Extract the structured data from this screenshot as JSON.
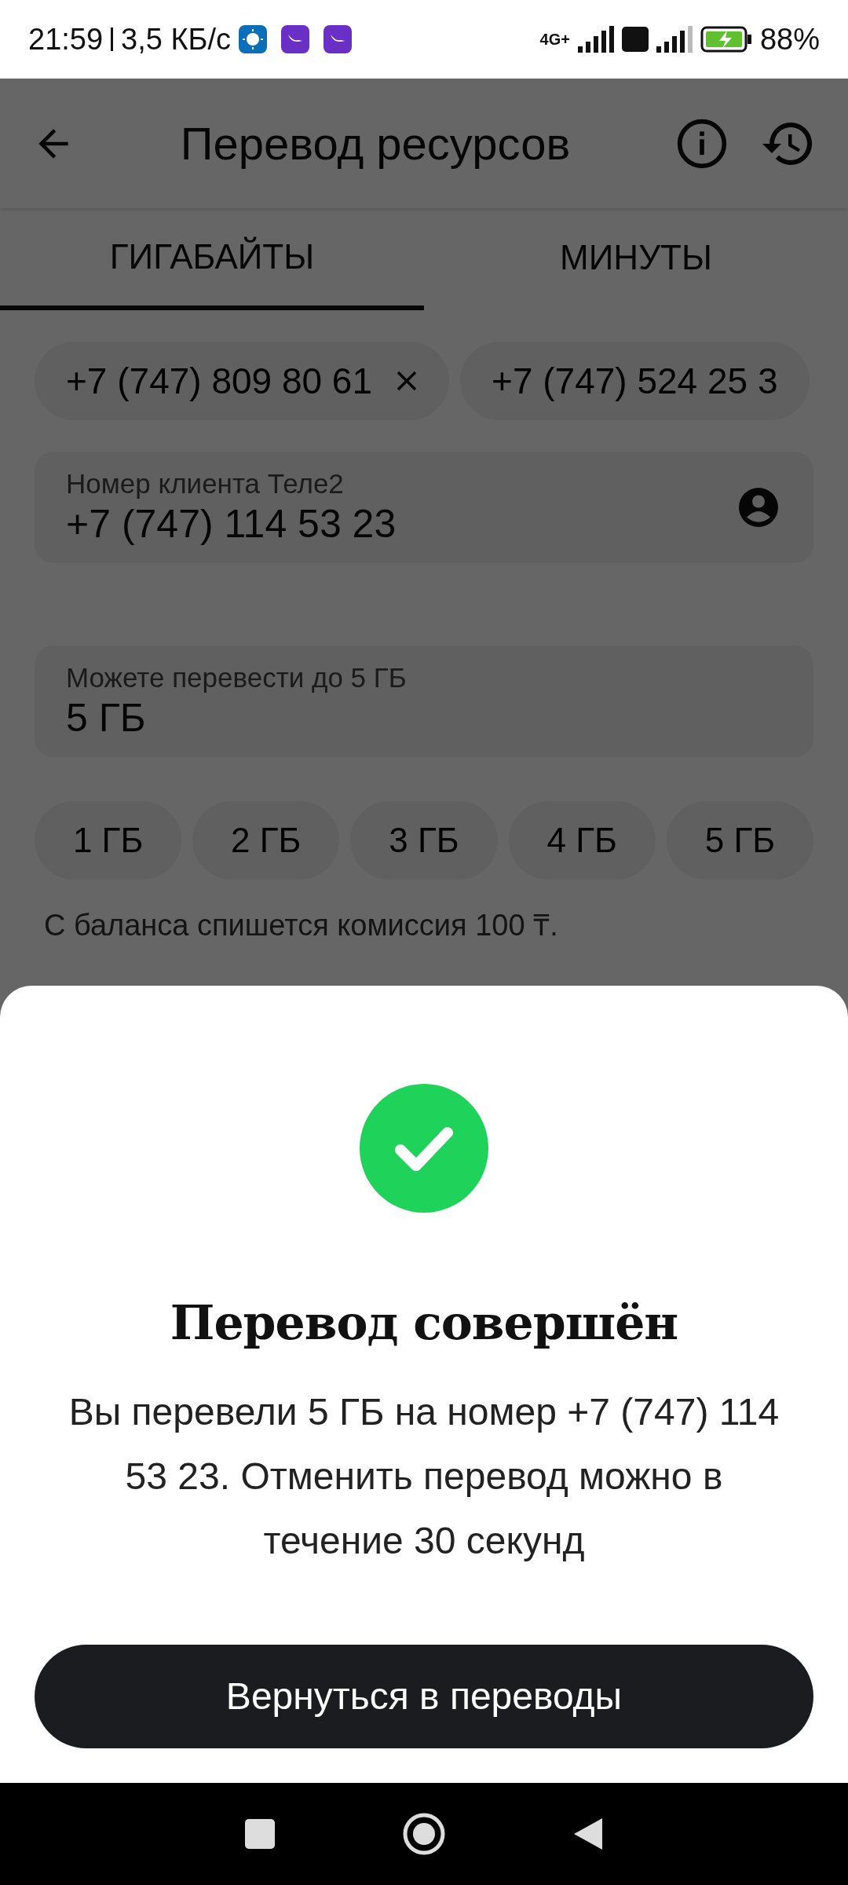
{
  "status_bar": {
    "time": "21:59",
    "speed": "3,5 КБ/с",
    "network": "4G+",
    "battery": "88%"
  },
  "app_bar": {
    "title": "Перевод ресурсов"
  },
  "tabs": [
    {
      "label": "ГИГАБАЙТЫ",
      "selected": true
    },
    {
      "label": "МИНУТЫ",
      "selected": false
    }
  ],
  "recent_numbers": [
    {
      "number": "+7 (747) 809 80 61",
      "removable": true
    },
    {
      "number": "+7 (747) 524 25 3",
      "removable": false
    }
  ],
  "recipient_field": {
    "label": "Номер клиента Теле2",
    "value": "+7 (747) 114 53 23"
  },
  "amount_field": {
    "label": "Можете перевести до 5 ГБ",
    "value": "5 ГБ"
  },
  "quick_amounts": [
    "1 ГБ",
    "2 ГБ",
    "3 ГБ",
    "4 ГБ",
    "5 ГБ"
  ],
  "note": "С баланса спишется комиссия 100 ₸.",
  "dialog": {
    "title": "Перевод совершён",
    "message": "Вы перевели 5 ГБ на номер +7 (747) 114 53 23. Отменить перевод можно в течение 30 секунд",
    "button": "Вернуться в переводы"
  }
}
